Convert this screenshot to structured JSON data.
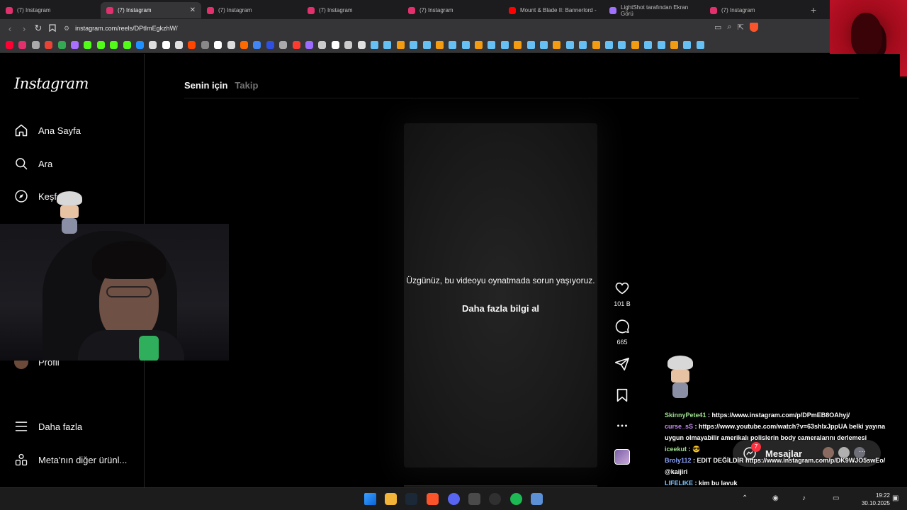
{
  "browser": {
    "tabs": [
      {
        "label": "(7) Instagram",
        "color": "#e1306c",
        "active": false
      },
      {
        "label": "(7) Instagram",
        "color": "#e1306c",
        "active": true
      },
      {
        "label": "(7) Instagram",
        "color": "#e1306c",
        "active": false
      },
      {
        "label": "(7) Instagram",
        "color": "#e1306c",
        "active": false
      },
      {
        "label": "(7) Instagram",
        "color": "#e1306c",
        "active": false
      },
      {
        "label": "Mount & Blade II: Bannerlord -",
        "color": "#ff0000",
        "active": false
      },
      {
        "label": "LightShot tarafından Ekran Görü",
        "color": "#a070ff",
        "active": false
      },
      {
        "label": "(7) Instagram",
        "color": "#e1306c",
        "active": false
      }
    ],
    "tab_close": "✕",
    "new_tab": "+",
    "url": "instagram.com/reels/DPtImEgkzhW/",
    "nav_back": "‹",
    "nav_forward": "›",
    "nav_reload": "↻",
    "bookmark_icon": "bookmark-icon"
  },
  "instagram": {
    "logo": "Instagram",
    "nav": {
      "home": "Ana Sayfa",
      "search": "Ara",
      "explore": "Keşfet",
      "profile": "Profil",
      "more": "Daha fazla",
      "meta": "Meta'nın diğer ürünl..."
    },
    "feed_tabs": {
      "for_you": "Senin için",
      "following": "Takip"
    },
    "video": {
      "error_text": "Üzgünüz, bu videoyu oynatmada sorun yaşıyoruz.",
      "learn_more": "Daha fazla bilgi al"
    },
    "actions": {
      "likes": "101 B",
      "comments": "665"
    },
    "messages": {
      "label": "Mesajlar",
      "badge": "7",
      "more": "···"
    }
  },
  "chat": {
    "lines": [
      {
        "user": "SkinnyPete41",
        "text": " : https://www.instagram.com/p/DPmEB8OAhyj/"
      },
      {
        "user": "curse_sS",
        "text": " : https://www.youtube.com/watch?v=63shlxJppUA belki yayına uygun olmayabilir amerikalı polislerin body cameralarını derlemesi"
      },
      {
        "user": "iceekut",
        "text": " : 😎"
      },
      {
        "user": "Broly112",
        "text": " : EDIT DEĞİLDİR https://www.instagram.com/p/DK9WJO5swEo/ @kaijiri"
      },
      {
        "user": "LIFELIKE",
        "text": " : kim bu lavuk"
      }
    ]
  },
  "taskbar": {
    "time": "19:22",
    "date": "30.10.2025",
    "chevron": "⌃"
  },
  "colors": {
    "instagram_bg": "#000000",
    "text_primary": "#f5f5f5",
    "text_muted": "#737373",
    "brave_orange": "#fb542b",
    "notification_red": "#ff3040"
  }
}
